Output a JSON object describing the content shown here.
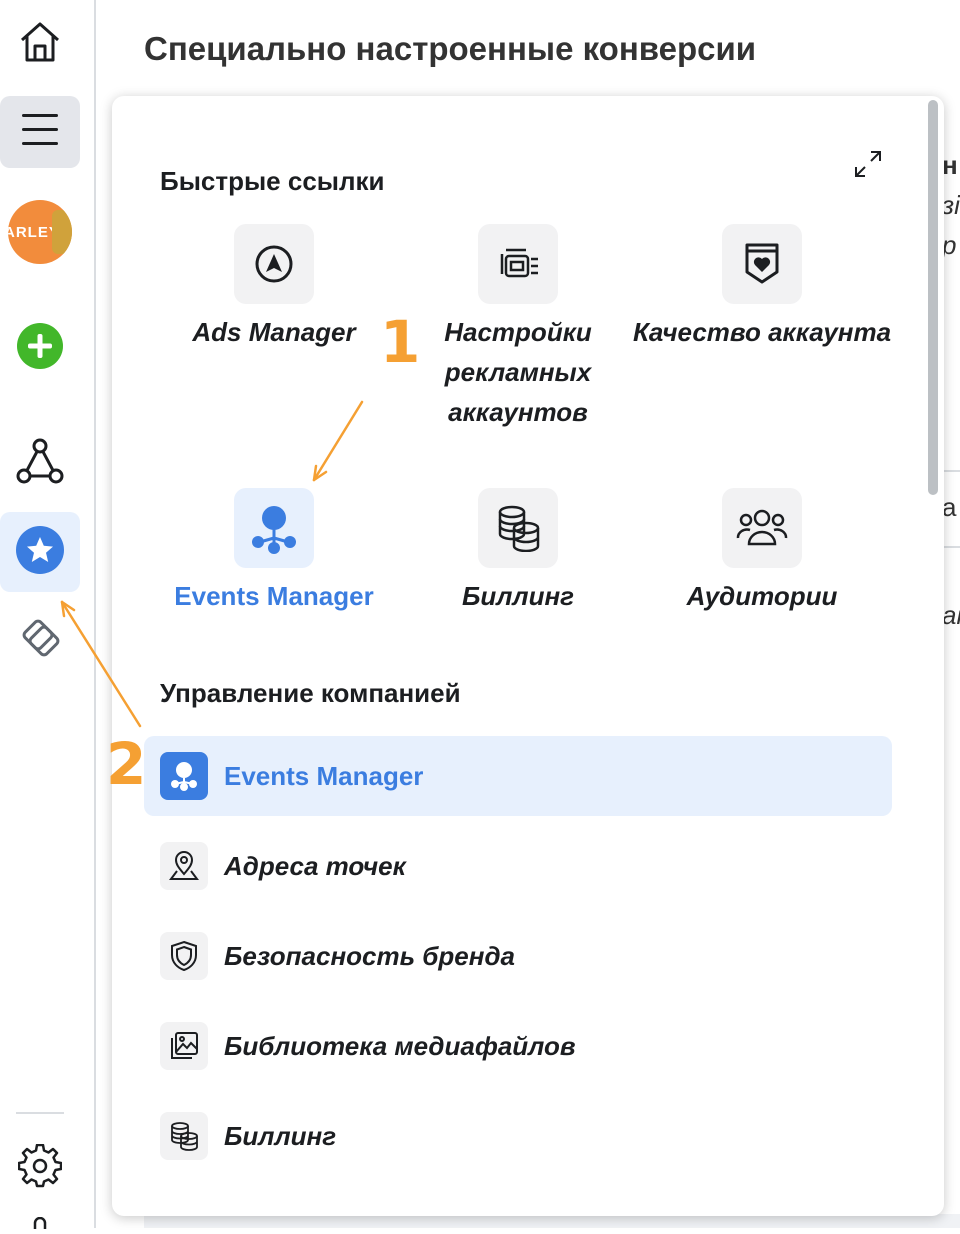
{
  "page": {
    "title": "Специально настроенные конверсии",
    "bg_fragments": [
      "н",
      "зі",
      "р",
      "а",
      "ак"
    ]
  },
  "rail": {
    "items": [
      {
        "icon": "home-icon"
      },
      {
        "icon": "menu-icon",
        "state": "selected"
      },
      {
        "icon": "avatar",
        "text": "ARLEY"
      },
      {
        "icon": "add-icon",
        "color": "#42b72a"
      },
      {
        "icon": "triangle-nodes-icon"
      },
      {
        "icon": "star-icon",
        "color": "#3b7de0",
        "state": "active"
      },
      {
        "icon": "handshake-icon"
      },
      {
        "icon": "gear-icon"
      }
    ]
  },
  "panel": {
    "quick_links_title": "Быстрые ссылки",
    "quick_links": [
      {
        "label": "Ads Manager",
        "icon": "navigation-arrow-icon"
      },
      {
        "label": "Настройки рекламных аккаунтов",
        "icon": "ad-settings-icon"
      },
      {
        "label": "Качество аккаунта",
        "icon": "shield-heart-icon"
      },
      {
        "label": "Events Manager",
        "icon": "events-manager-icon",
        "highlighted": true
      },
      {
        "label": "Биллинг",
        "icon": "coins-stack-icon"
      },
      {
        "label": "Аудитории",
        "icon": "audience-icon"
      }
    ],
    "manage_title": "Управление компанией",
    "manage_items": [
      {
        "label": "Events Manager",
        "icon": "events-manager-icon",
        "active": true
      },
      {
        "label": "Адреса точек",
        "icon": "location-pin-icon"
      },
      {
        "label": "Безопасность бренда",
        "icon": "shield-icon"
      },
      {
        "label": "Библиотека медиафайлов",
        "icon": "media-library-icon"
      },
      {
        "label": "Биллинг",
        "icon": "coins-stack-icon"
      }
    ]
  },
  "annotations": {
    "step1": "1",
    "step2": "2",
    "color": "#f5a033"
  },
  "colors": {
    "accent_blue": "#3b7de0",
    "highlight_bg": "#e7f0fd",
    "add_green": "#42b72a"
  }
}
